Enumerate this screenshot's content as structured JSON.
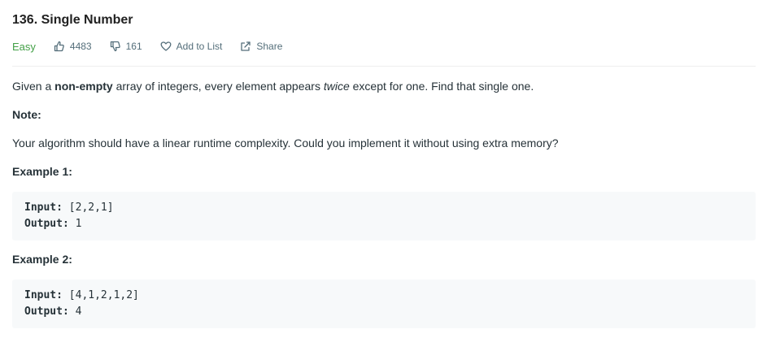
{
  "problem": {
    "title": "136. Single Number",
    "difficulty": "Easy",
    "likes": "4483",
    "dislikes": "161",
    "add_to_list": "Add to List",
    "share": "Share"
  },
  "description": {
    "p1_before": "Given a ",
    "p1_bold": "non-empty",
    "p1_mid": " array of integers, every element appears ",
    "p1_italic": "twice",
    "p1_after": " except for one. Find that single one.",
    "note_label": "Note:",
    "note_text": "Your algorithm should have a linear runtime complexity. Could you implement it without using extra memory?"
  },
  "examples": [
    {
      "heading": "Example 1:",
      "input_label": "Input:",
      "input_value": " [2,2,1]",
      "output_label": "Output:",
      "output_value": " 1"
    },
    {
      "heading": "Example 2:",
      "input_label": "Input:",
      "input_value": " [4,1,2,1,2]",
      "output_label": "Output:",
      "output_value": " 4"
    }
  ],
  "colors": {
    "difficulty_easy": "#43a047",
    "meta_text": "#546e7a",
    "code_bg": "#f7f9fa"
  },
  "icons": {
    "likes": "thumbs-up-icon",
    "dislikes": "thumbs-down-icon",
    "add_to_list": "heart-icon",
    "share": "share-icon"
  }
}
